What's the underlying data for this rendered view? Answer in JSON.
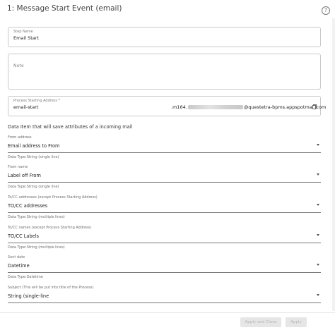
{
  "header": {
    "title": "1: Message Start Event (email)",
    "help_icon": "question-circle-icon"
  },
  "step_name": {
    "label": "Step Name",
    "value": "Email Start"
  },
  "note": {
    "placeholder": "Note"
  },
  "process_address": {
    "label": "Process Starting Address *",
    "value": "email-start",
    "address_prefix": ".m164.",
    "address_suffix": "@questetra-bpms.appspotmail.com",
    "copy_icon": "copy-icon"
  },
  "section_title": "Data Item that will save attributes of a incoming mail",
  "mappings": [
    {
      "label": "From address",
      "value": "Email address to From",
      "type": "Data Type:String (single line)"
    },
    {
      "label": "From name",
      "value": "Label off From",
      "type": "Data Type:String (single line)"
    },
    {
      "label": "To/CC addresses (except Process Starting Address)",
      "value": "TO/CC addresses",
      "type": "Data Type:String (multiple lines)"
    },
    {
      "label": "To/CC names (except Process Starting Address)",
      "value": "TO/CC Labels",
      "type": "Data Type:String (multiple lines)"
    },
    {
      "label": "Sent date",
      "value": "Datetime",
      "type": "Data Type:Datetime"
    },
    {
      "label": "Subject (This will be put into title of the Process)",
      "value": "String (single-line",
      "type": ""
    }
  ],
  "footer": {
    "apply_close_label": "Apply and Close",
    "apply_label": "Apply"
  }
}
